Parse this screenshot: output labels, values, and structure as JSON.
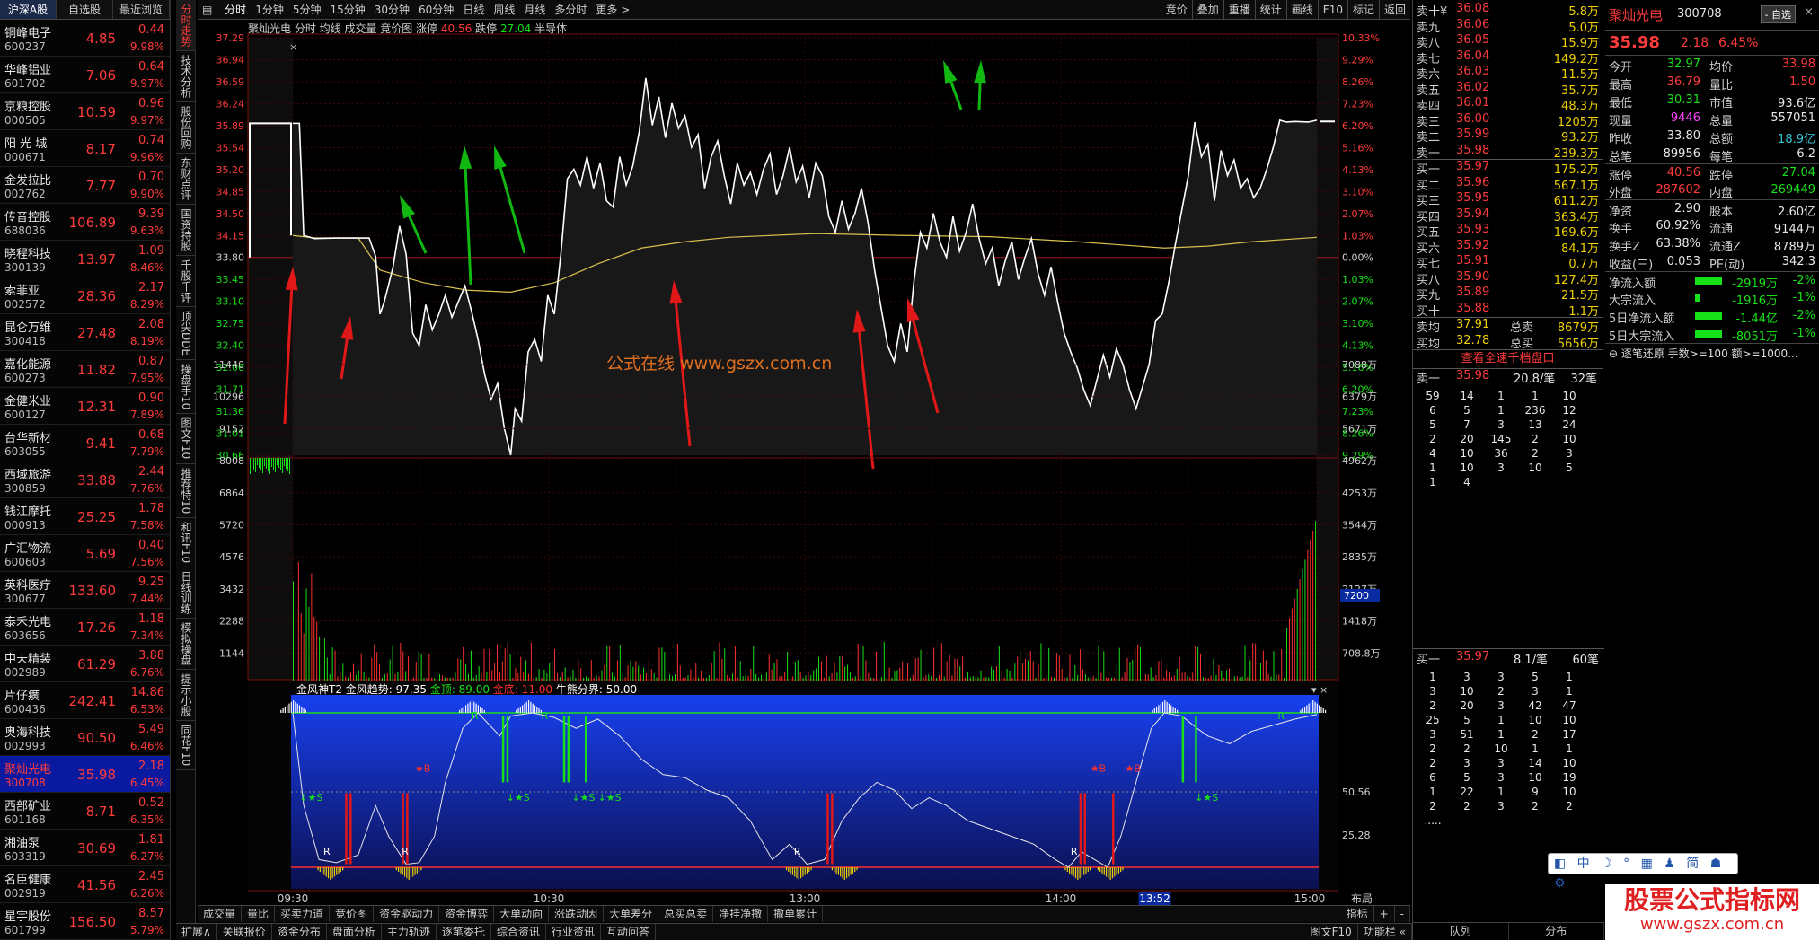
{
  "left_tabs": [
    "沪深A股",
    "自选股",
    "最近浏览"
  ],
  "stocks": [
    {
      "name": "铜峰电子",
      "code": "600237",
      "price": "4.85",
      "chg": "0.44",
      "pct": "9.98%"
    },
    {
      "name": "华峰铝业",
      "code": "601702",
      "price": "7.06",
      "chg": "0.64",
      "pct": "9.97%"
    },
    {
      "name": "京粮控股",
      "code": "000505",
      "price": "10.59",
      "chg": "0.96",
      "pct": "9.97%"
    },
    {
      "name": "阳 光 城",
      "code": "000671",
      "price": "8.17",
      "chg": "0.74",
      "pct": "9.96%"
    },
    {
      "name": "金发拉比",
      "code": "002762",
      "price": "7.77",
      "chg": "0.70",
      "pct": "9.90%"
    },
    {
      "name": "传音控股",
      "code": "688036",
      "price": "106.89",
      "chg": "9.39",
      "pct": "9.63%"
    },
    {
      "name": "晓程科技",
      "code": "300139",
      "price": "13.97",
      "chg": "1.09",
      "pct": "8.46%"
    },
    {
      "name": "索菲亚",
      "code": "002572",
      "price": "28.36",
      "chg": "2.17",
      "pct": "8.29%"
    },
    {
      "name": "昆仑万维",
      "code": "300418",
      "price": "27.48",
      "chg": "2.08",
      "pct": "8.19%"
    },
    {
      "name": "嘉化能源",
      "code": "600273",
      "price": "11.82",
      "chg": "0.87",
      "pct": "7.95%"
    },
    {
      "name": "金健米业",
      "code": "600127",
      "price": "12.31",
      "chg": "0.90",
      "pct": "7.89%"
    },
    {
      "name": "台华新材",
      "code": "603055",
      "price": "9.41",
      "chg": "0.68",
      "pct": "7.79%"
    },
    {
      "name": "西域旅游",
      "code": "300859",
      "price": "33.88",
      "chg": "2.44",
      "pct": "7.76%"
    },
    {
      "name": "钱江摩托",
      "code": "000913",
      "price": "25.25",
      "chg": "1.78",
      "pct": "7.58%"
    },
    {
      "name": "广汇物流",
      "code": "600603",
      "price": "5.69",
      "chg": "0.40",
      "pct": "7.56%"
    },
    {
      "name": "英科医疗",
      "code": "300677",
      "price": "133.60",
      "chg": "9.25",
      "pct": "7.44%"
    },
    {
      "name": "泰禾光电",
      "code": "603656",
      "price": "17.26",
      "chg": "1.18",
      "pct": "7.34%"
    },
    {
      "name": "中天精装",
      "code": "002989",
      "price": "61.29",
      "chg": "3.88",
      "pct": "6.76%"
    },
    {
      "name": "片仔癀",
      "code": "600436",
      "price": "242.41",
      "chg": "14.86",
      "pct": "6.53%"
    },
    {
      "name": "奥海科技",
      "code": "002993",
      "price": "90.50",
      "chg": "5.49",
      "pct": "6.46%"
    },
    {
      "name": "聚灿光电",
      "code": "300708",
      "price": "35.98",
      "chg": "2.18",
      "pct": "6.45%"
    },
    {
      "name": "西部矿业",
      "code": "601168",
      "price": "8.71",
      "chg": "0.52",
      "pct": "6.35%"
    },
    {
      "name": "湘油泵",
      "code": "603319",
      "price": "30.69",
      "chg": "1.81",
      "pct": "6.27%"
    },
    {
      "name": "名臣健康",
      "code": "002919",
      "price": "41.56",
      "chg": "2.45",
      "pct": "6.26%"
    },
    {
      "name": "星宇股份",
      "code": "601799",
      "price": "156.50",
      "chg": "8.57",
      "pct": "5.79%"
    }
  ],
  "selected_index": 20,
  "vtabs": [
    "分时走势",
    "技术分析",
    "股份回购",
    "东财点评",
    "国资持股",
    "千股千评",
    "顶尖DDE",
    "操盘手10",
    "图文F10",
    "推荐特10",
    "和讯F10",
    "日线训练",
    "模拟操盘",
    "提示小股",
    "同花F10"
  ],
  "toolbar_left": [
    "分时",
    "1分钟",
    "5分钟",
    "15分钟",
    "30分钟",
    "60分钟",
    "日线",
    "周线",
    "月线",
    "多分时",
    "更多 >"
  ],
  "toolbar_right": [
    "竞价",
    "叠加",
    "重播",
    "统计",
    "画线",
    "F10",
    "标记",
    "返回"
  ],
  "chart_header": {
    "name": "聚灿光电",
    "items": [
      "分时",
      "均线",
      "成交量",
      "竞价图"
    ],
    "limit_up_label": "涨停",
    "limit_up": "40.56",
    "limit_dn_label": "跌停",
    "limit_dn": "27.04",
    "sector": "半导体"
  },
  "price_ticks": [
    "37.29",
    "36.94",
    "36.59",
    "36.24",
    "35.89",
    "35.54",
    "35.20",
    "34.85",
    "34.50",
    "34.15",
    "33.80",
    "33.45",
    "33.10",
    "32.75",
    "32.40",
    "32.06",
    "31.71",
    "31.36",
    "31.01",
    "30.66"
  ],
  "pct_ticks": [
    "10.33%",
    "9.29%",
    "8.26%",
    "7.23%",
    "6.20%",
    "5.16%",
    "4.13%",
    "3.10%",
    "2.07%",
    "1.03%",
    "0.00%",
    "1.03%",
    "2.07%",
    "3.10%",
    "4.13%",
    "5.16%",
    "6.20%",
    "7.23%",
    "8.26%",
    "9.29%"
  ],
  "vol_ticks_left": [
    "11440",
    "10296",
    "9152",
    "8008",
    "6864",
    "5720",
    "4576",
    "3432",
    "2288",
    "1144"
  ],
  "vol_ticks_right": [
    "7088万",
    "6379万",
    "5671万",
    "4962万",
    "4253万",
    "3544万",
    "2835万",
    "2127万",
    "1418万",
    "708.8万"
  ],
  "vol_highlight": "7200",
  "watermark_text": "公式在线  www.gszx.com.cn",
  "indicator_header": {
    "name": "金风神T2",
    "trend_label": "金风趋势:",
    "trend": "97.35",
    "top_label": "金顶:",
    "top": "89.00",
    "bottom_label": "金底:",
    "bottom": "11.00",
    "bull_label": "牛熊分界:",
    "bull": "50.00"
  },
  "ind_ticks": [
    "50.56",
    "25.28"
  ],
  "marker_labels": {
    "buy": "B",
    "sell": "S",
    "reverse": "R"
  },
  "time_labels": [
    "09:30",
    "10:30",
    "13:00",
    "14:00",
    "15:00"
  ],
  "time_cursor": "13:52",
  "bottom_corner": "布局",
  "chart_tabs": [
    "成交量",
    "量比",
    "买卖力道",
    "竞价图",
    "资金驱动力",
    "资金博弈",
    "大单动向",
    "涨跌动因",
    "大单差分",
    "总买总卖",
    "净挂净撤",
    "撤单累计"
  ],
  "chart_tabs_right": [
    "指标",
    "+",
    "-"
  ],
  "footer_tabs": [
    "扩展∧",
    "关联报价",
    "资金分布",
    "盘面分析",
    "主力轨迹",
    "逐笔委托",
    "综合资讯",
    "行业资讯",
    "互动问答"
  ],
  "footer_right": [
    "图文F10",
    "功能栏 «"
  ],
  "chart_data": {
    "type": "line",
    "title": "聚灿光电 分时",
    "prev_close": 33.8,
    "ylim": [
      30.66,
      37.29
    ],
    "series": [
      {
        "name": "分时",
        "points": [
          [
            0,
            35.93
          ],
          [
            3,
            35.93
          ],
          [
            5,
            34.15
          ],
          [
            10,
            34.1
          ],
          [
            20,
            34.11
          ],
          [
            30,
            34.11
          ],
          [
            35,
            34.11
          ],
          [
            38,
            33.82
          ],
          [
            40,
            32.9
          ],
          [
            42,
            33.1
          ],
          [
            46,
            33.65
          ],
          [
            49,
            34.3
          ],
          [
            52,
            33.85
          ],
          [
            55,
            32.6
          ],
          [
            58,
            32.4
          ],
          [
            61,
            33.05
          ],
          [
            64,
            32.65
          ],
          [
            67,
            32.9
          ],
          [
            70,
            33.2
          ],
          [
            73,
            32.85
          ],
          [
            76,
            33.1
          ],
          [
            79,
            33.35
          ],
          [
            82,
            32.95
          ],
          [
            85,
            32.5
          ],
          [
            88,
            31.95
          ],
          [
            91,
            31.55
          ],
          [
            94,
            31.8
          ],
          [
            97,
            31.1
          ],
          [
            100,
            30.66
          ],
          [
            102,
            31.4
          ],
          [
            105,
            31.2
          ],
          [
            108,
            32.3
          ],
          [
            111,
            32.5
          ],
          [
            114,
            32.15
          ],
          [
            117,
            33.2
          ],
          [
            120,
            32.9
          ],
          [
            123,
            33.85
          ],
          [
            126,
            35.05
          ],
          [
            129,
            35.2
          ],
          [
            132,
            34.95
          ],
          [
            135,
            35.4
          ],
          [
            138,
            34.9
          ],
          [
            141,
            35.3
          ],
          [
            144,
            34.7
          ],
          [
            147,
            34.6
          ],
          [
            150,
            35.4
          ],
          [
            153,
            34.95
          ],
          [
            156,
            35.25
          ],
          [
            159,
            35.8
          ],
          [
            162,
            36.65
          ],
          [
            165,
            35.9
          ],
          [
            168,
            36.35
          ],
          [
            171,
            35.7
          ],
          [
            174,
            36.25
          ],
          [
            177,
            35.85
          ],
          [
            180,
            36.05
          ],
          [
            183,
            35.55
          ],
          [
            186,
            35.75
          ],
          [
            189,
            34.9
          ],
          [
            192,
            35.4
          ],
          [
            195,
            35.65
          ],
          [
            198,
            35.1
          ],
          [
            201,
            34.65
          ],
          [
            204,
            35.3
          ],
          [
            207,
            34.95
          ],
          [
            210,
            35.15
          ],
          [
            213,
            34.8
          ],
          [
            216,
            35.2
          ],
          [
            219,
            35.45
          ],
          [
            222,
            34.8
          ],
          [
            225,
            35.1
          ],
          [
            228,
            35.55
          ],
          [
            231,
            35.0
          ],
          [
            234,
            35.25
          ],
          [
            237,
            34.75
          ],
          [
            240,
            35.3
          ],
          [
            243,
            35.1
          ],
          [
            246,
            34.45
          ],
          [
            249,
            34.2
          ],
          [
            252,
            34.7
          ],
          [
            255,
            34.25
          ],
          [
            258,
            34.5
          ],
          [
            261,
            34.9
          ],
          [
            264,
            34.35
          ],
          [
            267,
            33.6
          ],
          [
            270,
            33.0
          ],
          [
            273,
            32.4
          ],
          [
            276,
            32.15
          ],
          [
            279,
            32.75
          ],
          [
            282,
            32.3
          ],
          [
            285,
            33.4
          ],
          [
            288,
            34.2
          ],
          [
            291,
            33.95
          ],
          [
            294,
            34.5
          ],
          [
            297,
            34.05
          ],
          [
            300,
            33.8
          ],
          [
            303,
            34.45
          ],
          [
            306,
            33.9
          ],
          [
            309,
            34.2
          ],
          [
            312,
            34.65
          ],
          [
            315,
            34.1
          ],
          [
            318,
            33.7
          ],
          [
            321,
            33.95
          ],
          [
            324,
            33.35
          ],
          [
            327,
            33.75
          ],
          [
            330,
            34.05
          ],
          [
            333,
            33.45
          ],
          [
            336,
            33.8
          ],
          [
            339,
            34.1
          ],
          [
            342,
            33.55
          ],
          [
            345,
            33.2
          ],
          [
            348,
            33.65
          ],
          [
            351,
            33.1
          ],
          [
            354,
            32.6
          ],
          [
            357,
            32.3
          ],
          [
            360,
            32.05
          ],
          [
            363,
            31.7
          ],
          [
            366,
            31.45
          ],
          [
            369,
            31.85
          ],
          [
            372,
            32.25
          ],
          [
            375,
            31.9
          ],
          [
            378,
            32.35
          ],
          [
            381,
            32.1
          ],
          [
            384,
            31.7
          ],
          [
            387,
            31.4
          ],
          [
            390,
            31.75
          ],
          [
            393,
            32.1
          ],
          [
            396,
            32.8
          ],
          [
            399,
            32.9
          ],
          [
            402,
            33.4
          ],
          [
            405,
            34.0
          ],
          [
            408,
            34.55
          ],
          [
            411,
            35.1
          ],
          [
            414,
            35.95
          ],
          [
            417,
            35.4
          ],
          [
            420,
            35.6
          ],
          [
            423,
            34.7
          ],
          [
            426,
            35.5
          ],
          [
            429,
            35.1
          ],
          [
            432,
            35.35
          ],
          [
            435,
            34.9
          ],
          [
            438,
            35.05
          ],
          [
            441,
            34.75
          ],
          [
            444,
            34.9
          ],
          [
            447,
            35.2
          ],
          [
            450,
            35.55
          ],
          [
            453,
            35.98
          ],
          [
            456,
            35.95
          ],
          [
            460,
            35.96
          ],
          [
            466,
            35.95
          ],
          [
            470,
            35.98
          ]
        ]
      },
      {
        "name": "均线",
        "points": [
          [
            0,
            34.15
          ],
          [
            10,
            34.11
          ],
          [
            30,
            34.11
          ],
          [
            40,
            33.6
          ],
          [
            60,
            33.4
          ],
          [
            80,
            33.28
          ],
          [
            100,
            33.25
          ],
          [
            120,
            33.4
          ],
          [
            140,
            33.7
          ],
          [
            160,
            33.95
          ],
          [
            180,
            34.05
          ],
          [
            200,
            34.12
          ],
          [
            240,
            34.18
          ],
          [
            280,
            34.15
          ],
          [
            320,
            34.13
          ],
          [
            360,
            34.05
          ],
          [
            400,
            33.95
          ],
          [
            420,
            33.98
          ],
          [
            440,
            34.05
          ],
          [
            470,
            34.12
          ]
        ]
      }
    ],
    "volume_max": 11440
  }
}
